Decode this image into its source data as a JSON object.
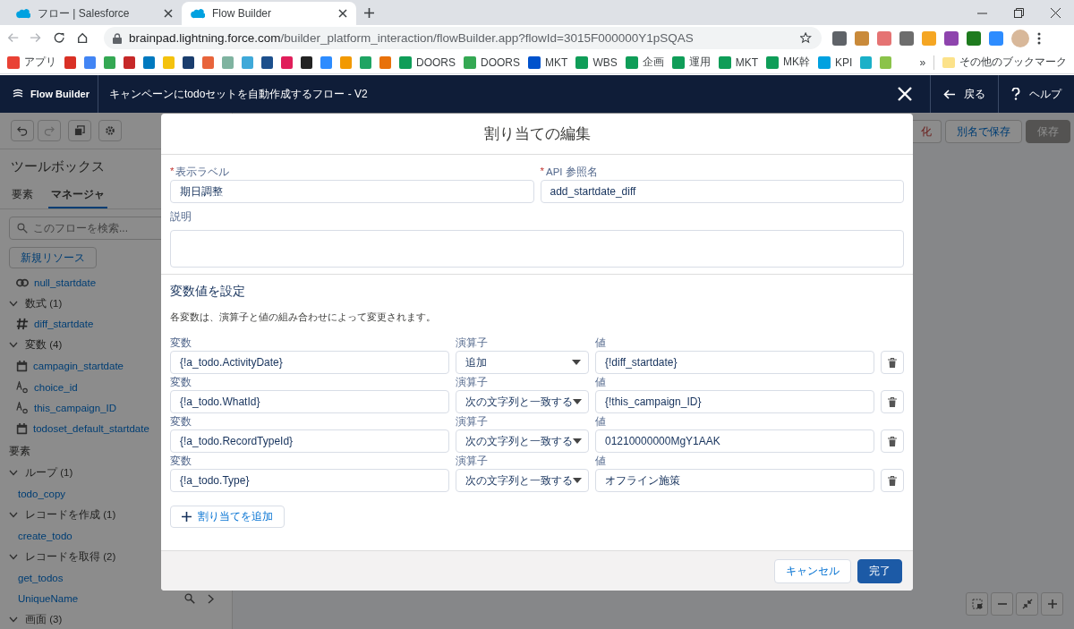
{
  "browser": {
    "tabs": [
      {
        "title": "フロー | Salesforce",
        "selected": false
      },
      {
        "title": "Flow Builder",
        "selected": true
      }
    ],
    "url": {
      "host": "brainpad.lightning.force.com",
      "path": "/builder_platform_interaction/flowBuilder.app?flowId=3015F000000Y1pSQAS"
    },
    "extensions": [
      {
        "color": "#5f6368"
      },
      {
        "color": "#c98a3a"
      },
      {
        "color": "#e57373"
      },
      {
        "color": "#6d6d6d"
      },
      {
        "color": "#f5a623"
      },
      {
        "color": "#8e44ad"
      },
      {
        "color": "#1e7b1e"
      },
      {
        "color": "#2d8cff"
      }
    ],
    "bookmarks": [
      {
        "label": "アプリ",
        "color": "#e94235"
      },
      {
        "color": "#d93025"
      },
      {
        "color": "#4285f4"
      },
      {
        "color": "#34a853"
      },
      {
        "color": "#c62828"
      },
      {
        "color": "#0079bf"
      },
      {
        "color": "#f4c20d"
      },
      {
        "color": "#1a3d6d"
      },
      {
        "color": "#e8643b"
      },
      {
        "color": "#7fb3a0"
      },
      {
        "color": "#3fa9d9"
      },
      {
        "color": "#1c4f8c"
      },
      {
        "color": "#e01e5a"
      },
      {
        "color": "#222222"
      },
      {
        "color": "#2d8cff"
      },
      {
        "color": "#f29900"
      },
      {
        "color": "#1fa463"
      },
      {
        "color": "#e8710a"
      },
      {
        "label": "DOORS",
        "color": "#0f9d58"
      },
      {
        "label": "DOORS",
        "color": "#34a853"
      },
      {
        "label": "MKT",
        "color": "#0052cc"
      },
      {
        "label": "WBS",
        "color": "#0f9d58"
      },
      {
        "label": "企画",
        "color": "#0f9d58"
      },
      {
        "label": "運用",
        "color": "#0f9d58"
      },
      {
        "label": "MKT",
        "color": "#0f9d58"
      },
      {
        "label": "MK幹",
        "color": "#0f9d58"
      },
      {
        "label": "KPI",
        "color": "#00a1e0"
      },
      {
        "color": "#1ab0c8"
      },
      {
        "color": "#8bc34a"
      }
    ],
    "overflow": "»",
    "other_bookmarks": "その他のブックマーク"
  },
  "app_header": {
    "product": "Flow Builder",
    "flow_title": "キャンペーンにtodoセットを自動作成するフロー - V2",
    "back": "戻る",
    "help": "ヘルプ"
  },
  "toolbar": {
    "buttons": [
      {
        "label": "化",
        "kind": "danger",
        "disabled": false
      },
      {
        "label": "別名で保存",
        "kind": "neutral",
        "disabled": false
      },
      {
        "label": "保存",
        "kind": "brand",
        "disabled": true
      }
    ]
  },
  "sidebar": {
    "title": "ツールボックス",
    "tabs": [
      {
        "label": "要素",
        "selected": false
      },
      {
        "label": "マネージャ",
        "selected": true
      }
    ],
    "search_placeholder": "このフローを検索...",
    "new_resource": "新規リソース",
    "resources": [
      {
        "kind": "link",
        "label": "null_startdate"
      },
      {
        "kind": "group",
        "label": "数式 (1)",
        "expanded": true,
        "children": [
          {
            "kind": "hash",
            "label": "diff_startdate"
          }
        ]
      },
      {
        "kind": "group",
        "label": "変数 (4)",
        "expanded": true,
        "children": [
          {
            "kind": "calendar",
            "label": "campagin_startdate"
          },
          {
            "kind": "text",
            "label": "choice_id"
          },
          {
            "kind": "text",
            "label": "this_campaign_ID"
          },
          {
            "kind": "calendar",
            "label": "todoset_default_startdate"
          }
        ]
      },
      {
        "kind": "heading",
        "label": "要素"
      },
      {
        "kind": "group",
        "label": "ループ (1)",
        "expanded": true,
        "children": [
          {
            "kind": "plain",
            "label": "todo_copy"
          }
        ]
      },
      {
        "kind": "group",
        "label": "レコードを作成 (1)",
        "expanded": true,
        "children": [
          {
            "kind": "plain",
            "label": "create_todo"
          }
        ]
      },
      {
        "kind": "group",
        "label": "レコードを取得 (2)",
        "expanded": true,
        "children": [
          {
            "kind": "plain",
            "label": "get_todos"
          },
          {
            "kind": "plain",
            "label": "UniqueName",
            "show_actions": true
          }
        ]
      },
      {
        "kind": "group",
        "label": "画面 (3)",
        "expanded": true
      }
    ]
  },
  "modal": {
    "title": "割り当ての編集",
    "label_field": {
      "required_mark": "*",
      "label": "表示ラベル",
      "value": "期日調整"
    },
    "api_field": {
      "required_mark": "*",
      "label": "API 参照名",
      "value": "add_startdate_diff"
    },
    "description": {
      "label": "説明"
    },
    "section_title": "変数値を設定",
    "section_help": "各変数は、演算子と値の組み合わせによって変更されます。",
    "assignments": [
      {
        "variable_label": "変数",
        "variable": "{!a_todo.ActivityDate}",
        "operator_label": "演算子",
        "operator": "追加",
        "value_label": "値",
        "value": "{!diff_startdate}"
      },
      {
        "variable_label": "変数",
        "variable": "{!a_todo.WhatId}",
        "operator_label": "演算子",
        "operator": "次の文字列と一致する",
        "value_label": "値",
        "value": "{!this_campaign_ID}"
      },
      {
        "variable_label": "変数",
        "variable": "{!a_todo.RecordTypeId}",
        "operator_label": "演算子",
        "operator": "次の文字列と一致する",
        "value_label": "値",
        "value": "01210000000MgY1AAK"
      },
      {
        "variable_label": "変数",
        "variable": "{!a_todo.Type}",
        "operator_label": "演算子",
        "operator": "次の文字列と一致する",
        "value_label": "値",
        "value": "オフライン施策"
      }
    ],
    "add_button": "割り当てを追加",
    "cancel": "キャンセル",
    "done": "完了"
  }
}
